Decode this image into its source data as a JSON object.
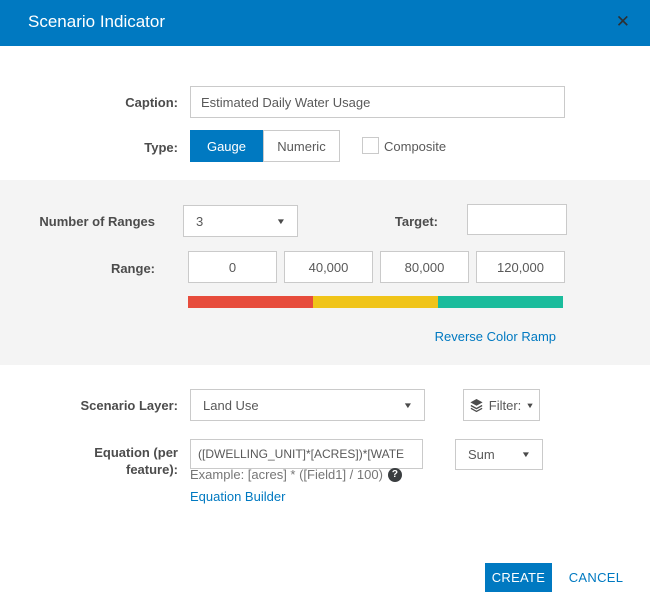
{
  "dialog": {
    "title": "Scenario Indicator"
  },
  "icons": {
    "close": "✕",
    "dropdown_arrow": "▼",
    "help": "?"
  },
  "caption": {
    "label": "Caption:",
    "value": "Estimated Daily Water Usage"
  },
  "type": {
    "label": "Type:",
    "gauge": "Gauge",
    "numeric": "Numeric",
    "selected": "Gauge",
    "composite_label": "Composite",
    "composite_checked": false
  },
  "ranges": {
    "number_label": "Number of Ranges",
    "number_value": "3",
    "target_label": "Target:",
    "target_value": "",
    "range_label": "Range:",
    "values": [
      "0",
      "40,000",
      "80,000",
      "120,000"
    ],
    "ramp_colors": [
      "#e74c3c",
      "#f0c419",
      "#1abc9c"
    ],
    "reverse_link": "Reverse Color Ramp"
  },
  "layer": {
    "label": "Scenario Layer:",
    "value": "Land Use",
    "filter_label": "Filter:"
  },
  "equation": {
    "label_line1": "Equation (per",
    "label_line2": "feature):",
    "value": "([DWELLING_UNIT]*[ACRES])*[WATE",
    "aggregation": "Sum",
    "example": "Example: [acres] * ([Field1] / 100)",
    "builder_link": "Equation Builder"
  },
  "footer": {
    "create": "CREATE",
    "cancel": "CANCEL"
  },
  "colors": {
    "accent": "#0079c1",
    "panel": "#f4f4f4"
  }
}
